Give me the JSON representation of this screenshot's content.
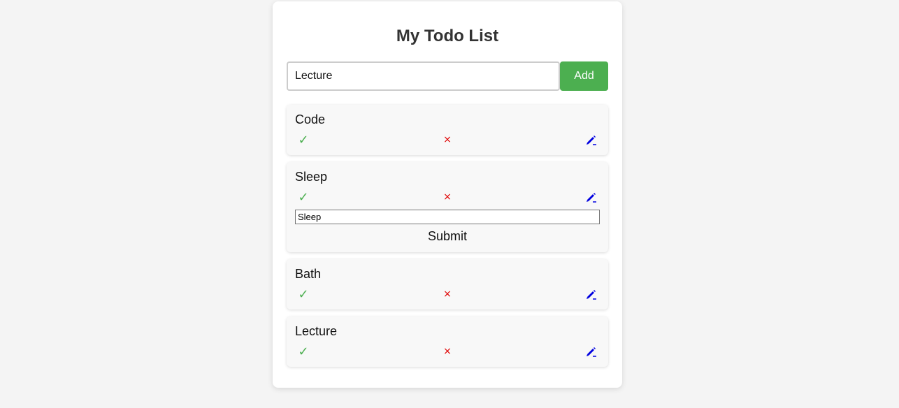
{
  "header": {
    "title": "My Todo List"
  },
  "add_form": {
    "input_value": "Lecture",
    "button_label": "Add"
  },
  "icons": {
    "complete": "✓",
    "delete": "×",
    "edit": "pencil-icon"
  },
  "colors": {
    "add_button": "#4caf50",
    "complete_icon": "#4caf50",
    "delete_icon": "#e00000",
    "edit_icon": "#0000e0"
  },
  "todos": [
    {
      "title": "Code"
    },
    {
      "title": "Sleep",
      "editing": true,
      "edit_value": "Sleep",
      "submit_label": "Submit"
    },
    {
      "title": "Bath"
    },
    {
      "title": "Lecture"
    }
  ]
}
